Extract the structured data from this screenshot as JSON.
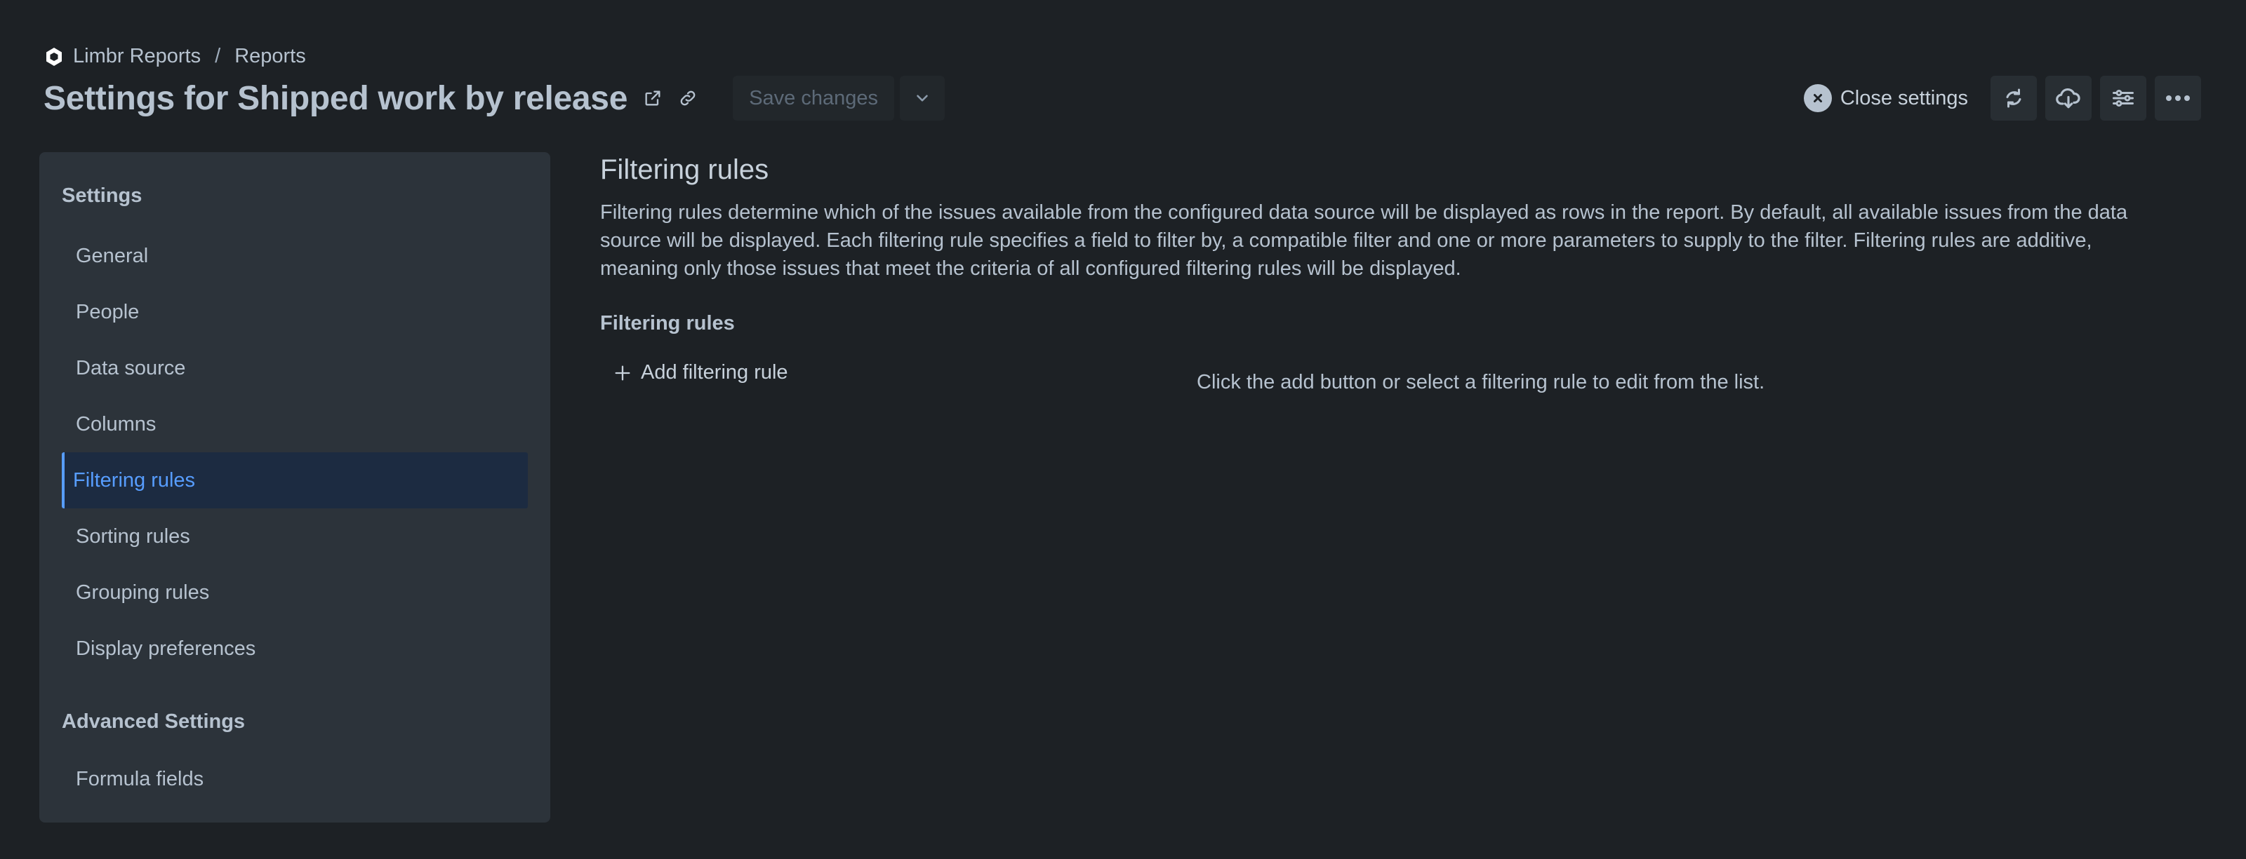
{
  "breadcrumb": {
    "app": "Limbr Reports",
    "separator": "/",
    "current": "Reports"
  },
  "title": "Settings for Shipped work by release",
  "toolbar": {
    "save_label": "Save changes",
    "close_label": "Close settings"
  },
  "sidebar": {
    "settings_heading": "Settings",
    "items": [
      {
        "label": "General"
      },
      {
        "label": "People"
      },
      {
        "label": "Data source"
      },
      {
        "label": "Columns"
      },
      {
        "label": "Filtering rules",
        "active": true
      },
      {
        "label": "Sorting rules"
      },
      {
        "label": "Grouping rules"
      },
      {
        "label": "Display preferences"
      }
    ],
    "advanced_heading": "Advanced Settings",
    "advanced_items": [
      {
        "label": "Formula fields"
      }
    ]
  },
  "main": {
    "heading": "Filtering rules",
    "description": "Filtering rules determine which of the issues available from the configured data source will be displayed as rows in the report. By default, all available issues from the data source will be displayed. Each filtering rule specifies a field to filter by, a compatible filter and one or more parameters to supply to the filter. Filtering rules are additive, meaning only those issues that meet the criteria of all configured filtering rules will be displayed.",
    "subheading": "Filtering rules",
    "add_label": "Add filtering rule",
    "empty_message": "Click the add button or select a filtering rule to edit from the list."
  },
  "colors": {
    "background": "#1d2125",
    "panel": "#2c333a",
    "accent": "#579dff",
    "active_bg": "#1c2b41"
  }
}
